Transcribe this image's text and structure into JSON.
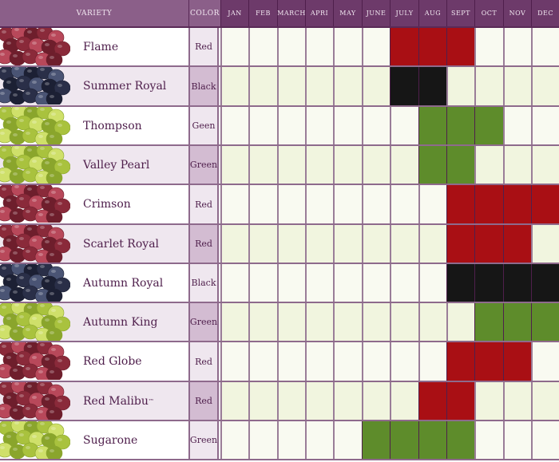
{
  "chart_data": {
    "type": "heatmap",
    "title": "",
    "headers": {
      "variety": "VARIETY",
      "color": "COLOR"
    },
    "months": [
      "JAN",
      "FEB",
      "MARCH",
      "APRI",
      "MAY",
      "JUNE",
      "JULY",
      "AUG",
      "SEPT",
      "OCT",
      "NOV",
      "DEC"
    ],
    "legend_colors": {
      "Red": "#a90f14",
      "Black": "#161616",
      "Green": "#5e8c2b"
    },
    "rows": [
      {
        "variety": "Flame",
        "tm": "",
        "color": "Red",
        "color_key": "Red",
        "available": [
          "JULY",
          "AUG",
          "SEPT"
        ]
      },
      {
        "variety": "Summer Royal",
        "tm": "",
        "color": "Black",
        "color_key": "Black",
        "available": [
          "JULY",
          "AUG"
        ]
      },
      {
        "variety": "Thompson",
        "tm": "",
        "color": "Geen",
        "color_key": "Green",
        "available": [
          "AUG",
          "SEPT",
          "OCT"
        ]
      },
      {
        "variety": "Valley Pearl",
        "tm": "",
        "color": "Green",
        "color_key": "Green",
        "available": [
          "AUG",
          "SEPT"
        ]
      },
      {
        "variety": "Crimson",
        "tm": "",
        "color": "Red",
        "color_key": "Red",
        "available": [
          "SEPT",
          "OCT",
          "NOV",
          "DEC"
        ]
      },
      {
        "variety": "Scarlet Royal",
        "tm": "",
        "color": "Red",
        "color_key": "Red",
        "available": [
          "SEPT",
          "OCT",
          "NOV"
        ]
      },
      {
        "variety": "Autumn Royal",
        "tm": "",
        "color": "Black",
        "color_key": "Black",
        "available": [
          "SEPT",
          "OCT",
          "NOV",
          "DEC"
        ]
      },
      {
        "variety": "Autumn King",
        "tm": "",
        "color": "Green",
        "color_key": "Green",
        "available": [
          "OCT",
          "NOV",
          "DEC"
        ]
      },
      {
        "variety": "Red Globe",
        "tm": "",
        "color": "Red",
        "color_key": "Red",
        "available": [
          "SEPT",
          "OCT",
          "NOV"
        ]
      },
      {
        "variety": "Red Malibu",
        "tm": "™",
        "color": "Red",
        "color_key": "Red",
        "available": [
          "AUG",
          "SEPT"
        ]
      },
      {
        "variety": "Sugarone",
        "tm": "",
        "color": "Green",
        "color_key": "Green",
        "available": [
          "JUNE",
          "JULY",
          "AUG",
          "SEPT"
        ]
      }
    ]
  }
}
